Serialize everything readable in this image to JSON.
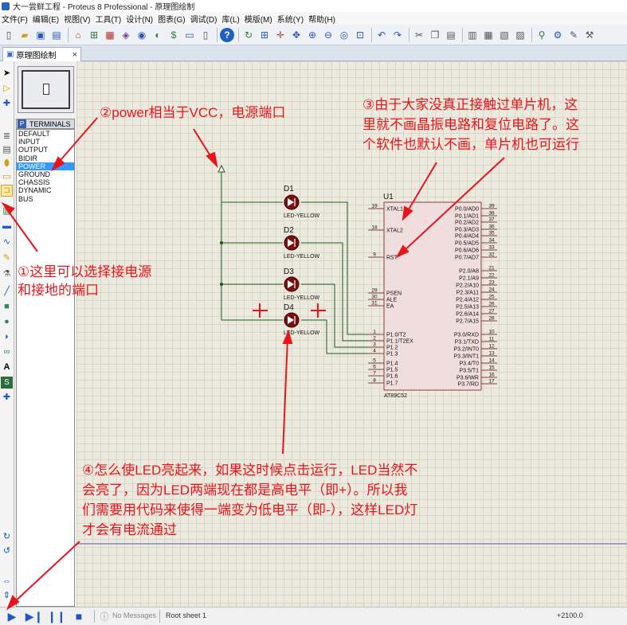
{
  "window": {
    "title": "大一尝鲜工程 - Proteus 8 Professional - 原理图绘制"
  },
  "menu": [
    "文件(F)",
    "编辑(E)",
    "视图(V)",
    "工具(T)",
    "设计(N)",
    "图表(G)",
    "调试(D)",
    "库(L)",
    "模版(M)",
    "系统(Y)",
    "帮助(H)"
  ],
  "tab": {
    "label": "原理图绘制",
    "close": "×"
  },
  "terminals": {
    "header": "TERMINALS",
    "badge": "P",
    "items": [
      "DEFAULT",
      "INPUT",
      "OUTPUT",
      "BIDIR",
      "POWER",
      "GROUND",
      "CHASSIS",
      "DYNAMIC",
      "BUS"
    ],
    "selected": "POWER"
  },
  "schematic": {
    "leds": [
      {
        "ref": "D1",
        "value": "LED-YELLOW"
      },
      {
        "ref": "D2",
        "value": "LED-YELLOW"
      },
      {
        "ref": "D3",
        "value": "LED-YELLOW"
      },
      {
        "ref": "D4",
        "value": "LED-YELLOW"
      }
    ],
    "mcu": {
      "ref": "U1",
      "part": "AT89C52",
      "left_pins": [
        {
          "num": "19",
          "name": "XTAL1"
        },
        {
          "num": "18",
          "name": "XTAL2"
        },
        {
          "num": "9",
          "name": "RST"
        },
        {
          "num": "29",
          "name": "PSEN"
        },
        {
          "num": "30",
          "name": "ALE"
        },
        {
          "num": "31",
          "name": "EA"
        },
        {
          "num": "1",
          "name": "P1.0/T2"
        },
        {
          "num": "2",
          "name": "P1.1/T2EX"
        },
        {
          "num": "3",
          "name": "P1.2"
        },
        {
          "num": "4",
          "name": "P1.3"
        },
        {
          "num": "5",
          "name": "P1.4"
        },
        {
          "num": "6",
          "name": "P1.5"
        },
        {
          "num": "7",
          "name": "P1.6"
        },
        {
          "num": "8",
          "name": "P1.7"
        }
      ],
      "right_pins": [
        {
          "num": "39",
          "name": "P0.0/AD0"
        },
        {
          "num": "38",
          "name": "P0.1/AD1"
        },
        {
          "num": "37",
          "name": "P0.2/AD2"
        },
        {
          "num": "36",
          "name": "P0.3/AD3"
        },
        {
          "num": "35",
          "name": "P0.4/AD4"
        },
        {
          "num": "34",
          "name": "P0.5/AD5"
        },
        {
          "num": "33",
          "name": "P0.6/AD6"
        },
        {
          "num": "32",
          "name": "P0.7/AD7"
        },
        {
          "num": "21",
          "name": "P2.0/A8"
        },
        {
          "num": "22",
          "name": "P2.1/A9"
        },
        {
          "num": "23",
          "name": "P2.2/A10"
        },
        {
          "num": "24",
          "name": "P2.3/A11"
        },
        {
          "num": "25",
          "name": "P2.4/A12"
        },
        {
          "num": "26",
          "name": "P2.5/A13"
        },
        {
          "num": "27",
          "name": "P2.6/A14"
        },
        {
          "num": "28",
          "name": "P2.7/A15"
        },
        {
          "num": "10",
          "name": "P3.0/RXD"
        },
        {
          "num": "11",
          "name": "P3.1/TXD"
        },
        {
          "num": "12",
          "name": "P3.2/INT0"
        },
        {
          "num": "13",
          "name": "P3.3/INT1"
        },
        {
          "num": "14",
          "name": "P3.4/T0"
        },
        {
          "num": "15",
          "name": "P3.5/T1"
        },
        {
          "num": "16",
          "name": "P3.6/WR"
        },
        {
          "num": "17",
          "name": "P3.7/RD"
        }
      ]
    },
    "plus_marks": [
      "+",
      "+"
    ]
  },
  "annotations": {
    "power": "②power相当于VCC，电源端口",
    "select": [
      "①这里可以选择接电源",
      "和接地的端口"
    ],
    "crystal": [
      "③由于大家没真正接触过单片机，这",
      "里就不画晶振电路和复位电路了。这",
      "个软件也默认不画，单片机也可运行"
    ],
    "led": [
      "④怎么使LED亮起来，如果这时候点击运行，LED当然不",
      "会亮了，因为LED两端现在都是高电平（即+）。所以我",
      "们需要用代码来使得一端变为低电平（即-），这样LED灯",
      "才会有电流通过"
    ]
  },
  "status": {
    "messages": "No Messages",
    "sheet": "Root sheet 1",
    "coord": "+2100.0"
  },
  "colors": {
    "annotation": "#e8141c",
    "wire": "#1f5a1f",
    "chip_fill": "#f0dede",
    "chip_stroke": "#8b3a3a",
    "selected": "#3399ff"
  }
}
